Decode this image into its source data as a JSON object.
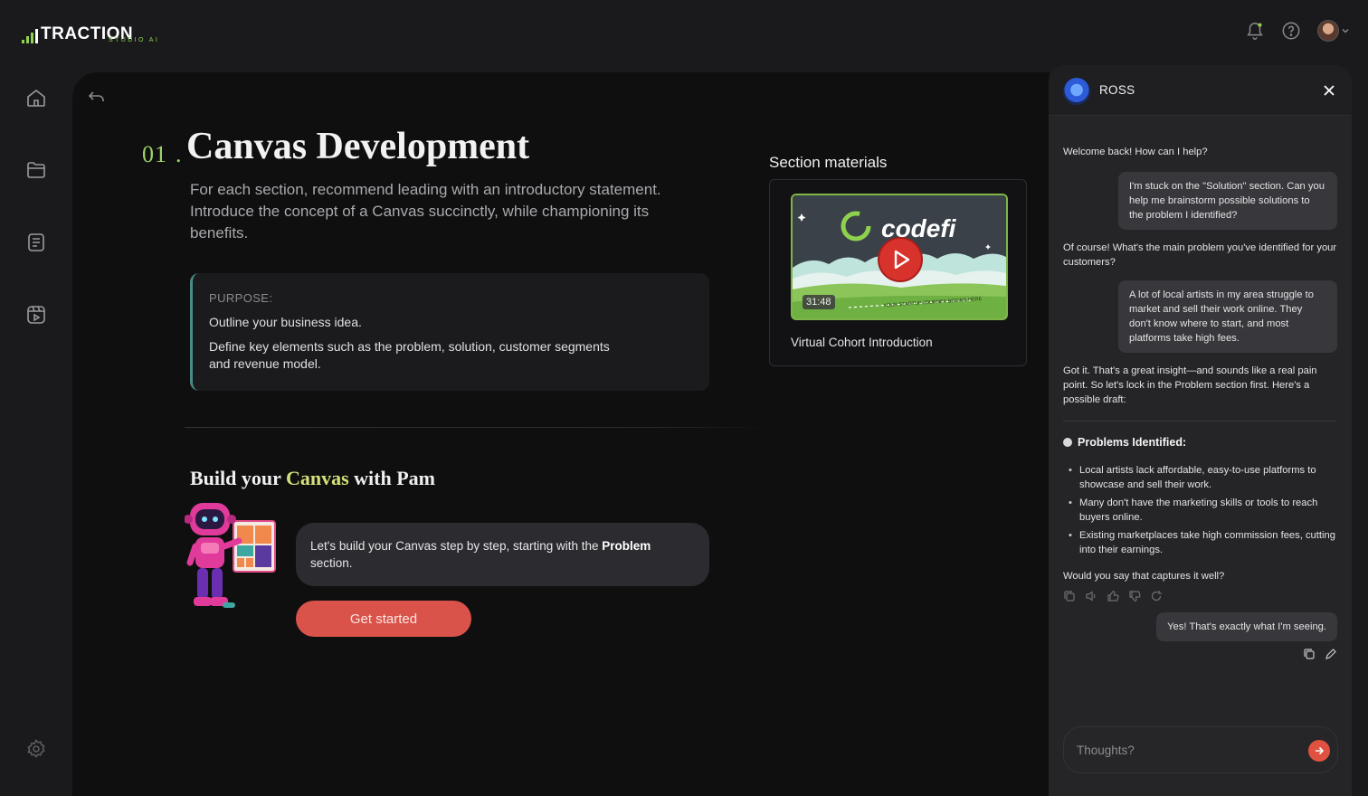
{
  "brand": {
    "name": "TRACTION",
    "sub": "STUDIO AI",
    "accent": "#8fd14f"
  },
  "topbar": {
    "icons": [
      "bell-icon",
      "help-icon",
      "avatar"
    ]
  },
  "nav": {
    "items": [
      "home-icon",
      "folder-icon",
      "notes-icon",
      "video-icon"
    ],
    "footer": "settings-icon"
  },
  "section": {
    "number": "01",
    "title": "Canvas Development",
    "description": "For each section, recommend leading with an introductory statement. Introduce the concept of a Canvas succinctly, while championing its benefits.",
    "purpose_label": "PURPOSE:",
    "purpose_lines": [
      "Outline your business idea.",
      "Define key elements such as the problem, solution, customer segments and revenue model."
    ]
  },
  "build": {
    "title_pre": "Build your ",
    "title_hl": "Canvas",
    "title_post": " with Pam",
    "bubble_pre": "Let's build your Canvas step by step, starting with the ",
    "bubble_bold": "Problem",
    "bubble_post": " section.",
    "cta": "Get started",
    "cta_color": "#d9534a"
  },
  "materials": {
    "title": "Section materials",
    "video": {
      "brand": "codefi",
      "duration": "31:48",
      "tagline": "YOUR STARTUP JOURNEY BEGINS HERE",
      "caption": "Virtual Cohort Introduction"
    }
  },
  "chat": {
    "name": "ROSS",
    "messages": [
      {
        "role": "ai",
        "text": "Welcome back! How can I help?"
      },
      {
        "role": "user",
        "text": "I'm stuck on the \"Solution\" section. Can you help me brainstorm possible solutions to the problem I identified?"
      },
      {
        "role": "ai",
        "text": "Of course! What's the main problem you've identified for your customers?"
      },
      {
        "role": "user",
        "text": "A lot of local artists in my area struggle to market and sell their work online. They don't know where to start, and most platforms take high fees."
      },
      {
        "role": "ai",
        "text": "Got it. That's a great insight—and sounds like a real pain point. So let's lock in the Problem section first. Here's a possible draft:"
      }
    ],
    "problems_title": "Problems Identified:",
    "problems": [
      "Local artists lack affordable, easy-to-use platforms to showcase and sell their work.",
      "Many don't have the marketing skills or tools to reach buyers online.",
      "Existing marketplaces take high commission fees, cutting into their earnings."
    ],
    "followup": "Would you say that captures it well?",
    "reply": "Yes! That's exactly what I'm seeing.",
    "input_placeholder": "Thoughts?",
    "send_color": "#e0523f"
  }
}
